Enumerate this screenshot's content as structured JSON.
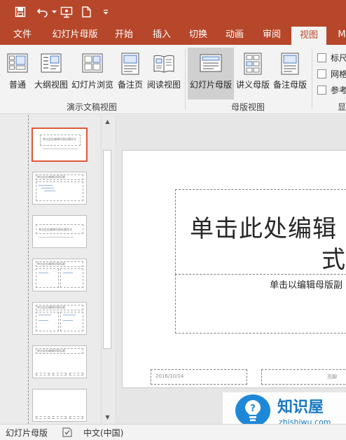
{
  "colors": {
    "accent": "#b7472a",
    "selection": "#e0593a",
    "watermark": "#1779c4"
  },
  "quick_access": {
    "icons": [
      "save-icon",
      "undo-icon",
      "slideshow-start-icon",
      "new-file-icon",
      "customize-qat-icon"
    ]
  },
  "tabs": [
    {
      "label": "文件",
      "active": false
    },
    {
      "label": "幻灯片母版",
      "active": false
    },
    {
      "label": "开始",
      "active": false
    },
    {
      "label": "插入",
      "active": false
    },
    {
      "label": "切换",
      "active": false
    },
    {
      "label": "动画",
      "active": false
    },
    {
      "label": "审阅",
      "active": false
    },
    {
      "label": "视图",
      "active": true
    },
    {
      "label": "M",
      "active": false
    }
  ],
  "ribbon": {
    "presentation_views": {
      "label": "演示文稿视图",
      "buttons": [
        {
          "label": "普通",
          "icon": "normal-view-icon"
        },
        {
          "label": "大纲视图",
          "icon": "outline-view-icon"
        },
        {
          "label": "幻灯片浏览",
          "icon": "slide-sorter-icon"
        },
        {
          "label": "备注页",
          "icon": "notes-page-icon"
        },
        {
          "label": "阅读视图",
          "icon": "reading-view-icon"
        }
      ]
    },
    "master_views": {
      "label": "母版视图",
      "buttons": [
        {
          "label": "幻灯片母版",
          "icon": "slide-master-icon",
          "selected": true
        },
        {
          "label": "讲义母版",
          "icon": "handout-master-icon"
        },
        {
          "label": "备注母版",
          "icon": "notes-master-icon"
        }
      ]
    },
    "show": {
      "label": "显",
      "checkboxes": [
        {
          "label": "标尺",
          "checked": false
        },
        {
          "label": "网格",
          "checked": false
        },
        {
          "label": "参考",
          "checked": false
        }
      ]
    }
  },
  "thumbnails": {
    "count": 7,
    "selected_index": 0,
    "titles": [
      "单击此处编辑母版标题样式",
      "单击此处编辑母版标题样式",
      "单击此处编辑母版标题样式",
      "单击此处编辑母版标题样式",
      "单击此处编辑母版标题样式",
      "单击此处编辑母版标题样式",
      ""
    ]
  },
  "slide": {
    "title_line1": "单击此处编辑",
    "title_line2": "式",
    "subtitle": "单击以编辑母版副",
    "date": "2016/10/14",
    "footer": "页脚"
  },
  "watermark": {
    "name": "知识屋",
    "url": "zhishiwu.com"
  },
  "status": {
    "view": "幻灯片母版",
    "language": "中文(中国)"
  }
}
